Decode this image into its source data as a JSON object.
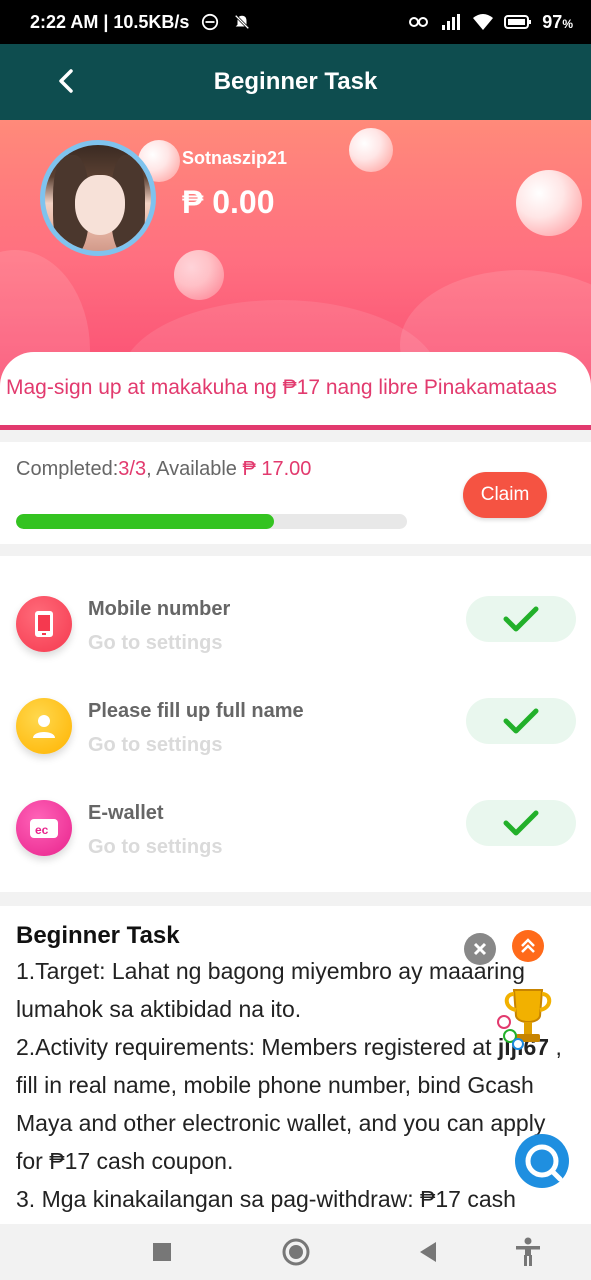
{
  "status_bar": {
    "time_speed": "2:22 AM | 10.5KB/s",
    "battery": "97"
  },
  "header": {
    "title": "Beginner Task"
  },
  "profile": {
    "username": "Sotnaszip21",
    "balance": "₱ 0.00"
  },
  "notice": {
    "text": "Mag-sign up at makakuha ng ₱17 nang libre Pinakamataas"
  },
  "progress": {
    "completed_label": "Completed:",
    "completed_value": "3/3",
    "available_label": ", Available ",
    "available_value": "₱ 17.00",
    "claim_label": "Claim",
    "fraction": 0.66
  },
  "tasks": [
    {
      "name": "Mobile number",
      "sub": "Go to settings",
      "icon": "phone-icon",
      "color": "#f5394f"
    },
    {
      "name": "Please fill up full name",
      "sub": "Go to settings",
      "icon": "user-icon",
      "color": "#ffc21a"
    },
    {
      "name": "E-wallet",
      "sub": "Go to settings",
      "icon": "wallet-icon",
      "color": "#f0369a"
    }
  ],
  "description": {
    "heading": "Beginner Task",
    "line1": "1.Target: Lahat ng bagong miyembro ay maaaring lumahok sa aktibidad na ito.",
    "line2_pre": "2.Activity requirements: Members registered at ",
    "line2_bold": "jljl67",
    "line2_post": " , fill in real name, mobile phone number, bind Gcash Maya and other electronic wallet, and you can apply for ₱17 cash coupon.",
    "line3": "3. Mga kinakailangan sa pag-withdraw: ₱17 cash"
  },
  "colors": {
    "header_bg": "#0e4d4f",
    "accent": "#e23a6e",
    "claim": "#f55342",
    "progress": "#34c321"
  }
}
